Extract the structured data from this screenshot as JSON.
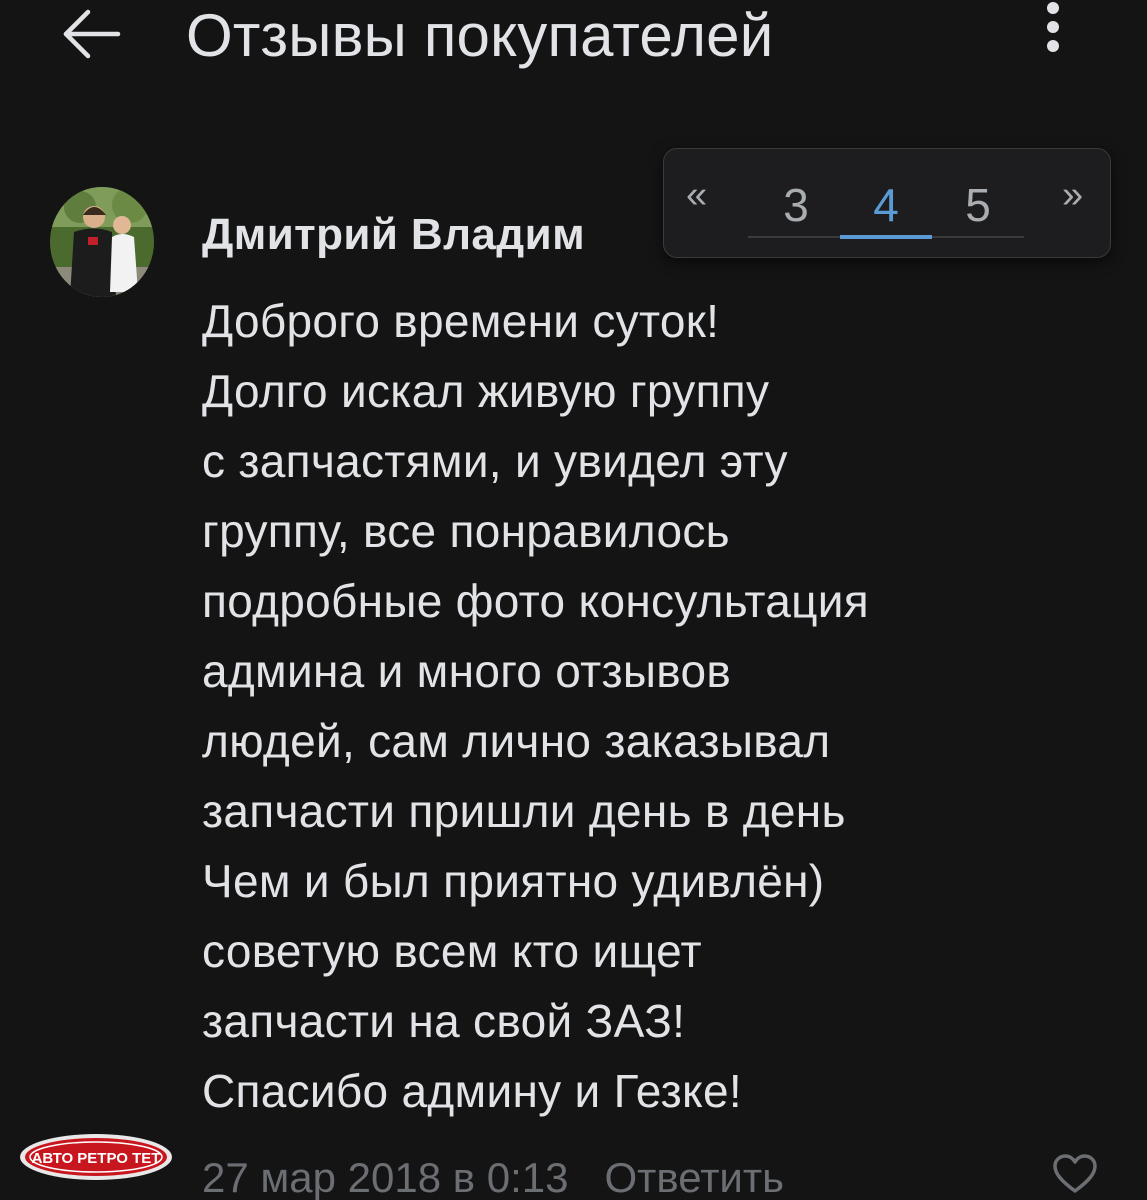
{
  "header": {
    "title": "Отзывы покупателей",
    "back_icon": "arrow-left-icon",
    "more_icon": "more-vertical-icon"
  },
  "comment": {
    "author": "Дмитрий Владим",
    "lines": [
      "Доброго времени суток!",
      "Долго искал живую группу",
      "с запчастями, и увидел эту",
      "группу, все понравилось",
      "подробные фото консультация",
      "админа и много отзывов",
      "людей, сам лично заказывал",
      "запчасти пришли день в день",
      "Чем и был приятно удивлён)",
      "советую всем кто ищет",
      "запчасти на свой ЗАЗ!",
      "Спасибо админу и Гезке!"
    ],
    "date": "27 мар 2018 в 0:13",
    "reply_label": "Ответить",
    "like_icon": "heart-icon"
  },
  "pager": {
    "prev_label": "«",
    "pages": [
      "3",
      "4",
      "5"
    ],
    "active_page": "4",
    "next_label": "»",
    "accent_color": "#5b9bd5"
  },
  "logo": {
    "text": "АВТО РЕТРО ТЕТ"
  },
  "colors": {
    "background": "#141414",
    "text": "#e1e3e6",
    "muted": "#6b6e72"
  }
}
